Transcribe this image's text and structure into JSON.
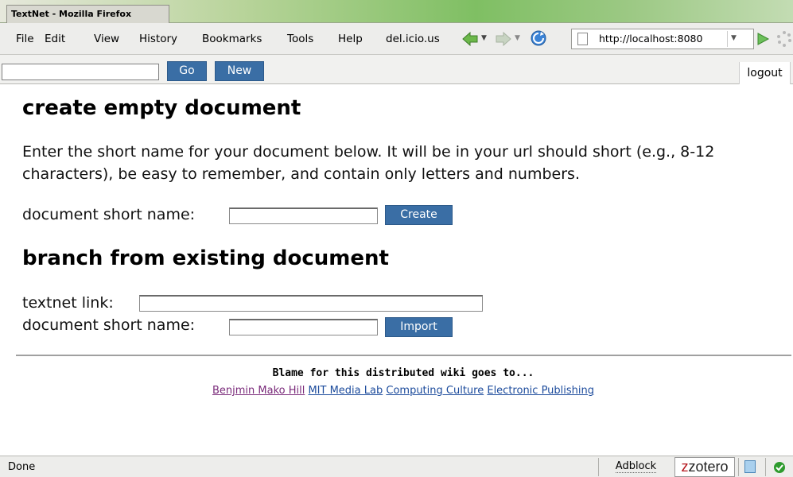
{
  "window": {
    "title": "TextNet - Mozilla Firefox"
  },
  "menubar": {
    "items": [
      {
        "label": "File"
      },
      {
        "label": "Edit"
      },
      {
        "label": "View"
      },
      {
        "label": "History"
      },
      {
        "label": "Bookmarks"
      },
      {
        "label": "Tools"
      },
      {
        "label": "Help"
      },
      {
        "label": "del.icio.us"
      }
    ],
    "url": "http://localhost:8080"
  },
  "toolbar": {
    "search_value": "",
    "go_label": "Go",
    "new_label": "New",
    "logout_label": "logout"
  },
  "create_section": {
    "title": "create empty document",
    "description": "Enter the short name for your document below. It will be in your url should short (e.g., 8-12 characters), be easy to remember, and contain only letters and numbers.",
    "short_name_label": "document short name:",
    "short_name_value": "",
    "create_label": "Create"
  },
  "branch_section": {
    "title": "branch from existing document",
    "link_label": "textnet link:",
    "link_value": "",
    "short_name_label": "document short name:",
    "short_name_value": "",
    "import_label": "Import"
  },
  "footer": {
    "blame_text": "Blame for this distributed wiki goes to...",
    "links": [
      {
        "label": "Benjmin Mako Hill"
      },
      {
        "label": "MIT Media Lab"
      },
      {
        "label": "Computing Culture"
      },
      {
        "label": "Electronic Publishing"
      }
    ]
  },
  "statusbar": {
    "status": "Done",
    "adblock_label": "Adblock",
    "zotero_label": "zotero"
  }
}
